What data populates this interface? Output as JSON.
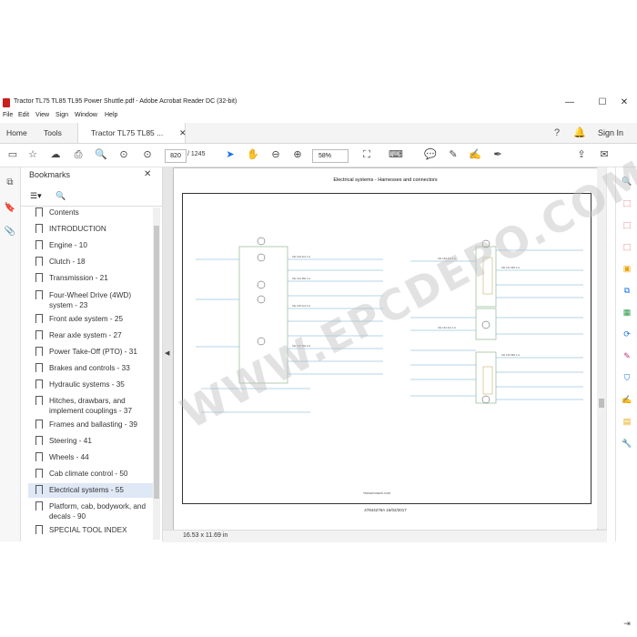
{
  "window": {
    "title": "Tractor TL75 TL85 TL95 Power Shuttle.pdf - Adobe Acrobat Reader DC (32-bit)",
    "controls": [
      "—",
      "☐",
      "✕"
    ]
  },
  "menu": [
    "File",
    "Edit",
    "View",
    "Sign",
    "Window",
    "Help"
  ],
  "tabs": {
    "home": "Home",
    "tools": "Tools",
    "document": "Tractor TL75 TL85 ...",
    "sign_in": "Sign In"
  },
  "toolbar": {
    "page_current": "820",
    "page_total": "/ 1245",
    "zoom": "58%"
  },
  "bookmarks": {
    "title": "Bookmarks",
    "items": [
      {
        "label": "Contents"
      },
      {
        "label": "INTRODUCTION"
      },
      {
        "label": "Engine - 10"
      },
      {
        "label": "Clutch - 18"
      },
      {
        "label": "Transmission - 21"
      },
      {
        "label": "Four-Wheel Drive (4WD) system - 23"
      },
      {
        "label": "Front axle system - 25"
      },
      {
        "label": "Rear axle system - 27"
      },
      {
        "label": "Power Take-Off (PTO) - 31"
      },
      {
        "label": "Brakes and controls - 33"
      },
      {
        "label": "Hydraulic systems - 35"
      },
      {
        "label": "Hitches, drawbars, and implement couplings - 37"
      },
      {
        "label": "Frames and ballasting - 39"
      },
      {
        "label": "Steering - 41"
      },
      {
        "label": "Wheels - 44"
      },
      {
        "label": "Cab climate control - 50"
      },
      {
        "label": "Electrical systems - 55",
        "selected": true
      },
      {
        "label": "Platform, cab, bodywork, and decals - 90"
      },
      {
        "label": "SPECIAL TOOL INDEX"
      }
    ]
  },
  "document": {
    "page_title": "Electrical systems - Harnesses and connectors",
    "footer_line1": "47844276A 16/02/2017",
    "page_size": "16.53 x 11.69 in"
  },
  "watermark": "WWW.EPCDEPO.COM",
  "colors": {
    "accent_blue": "#1473e6",
    "acrobat_red": "#c8201f",
    "selected_bg": "#dfe8f5"
  }
}
